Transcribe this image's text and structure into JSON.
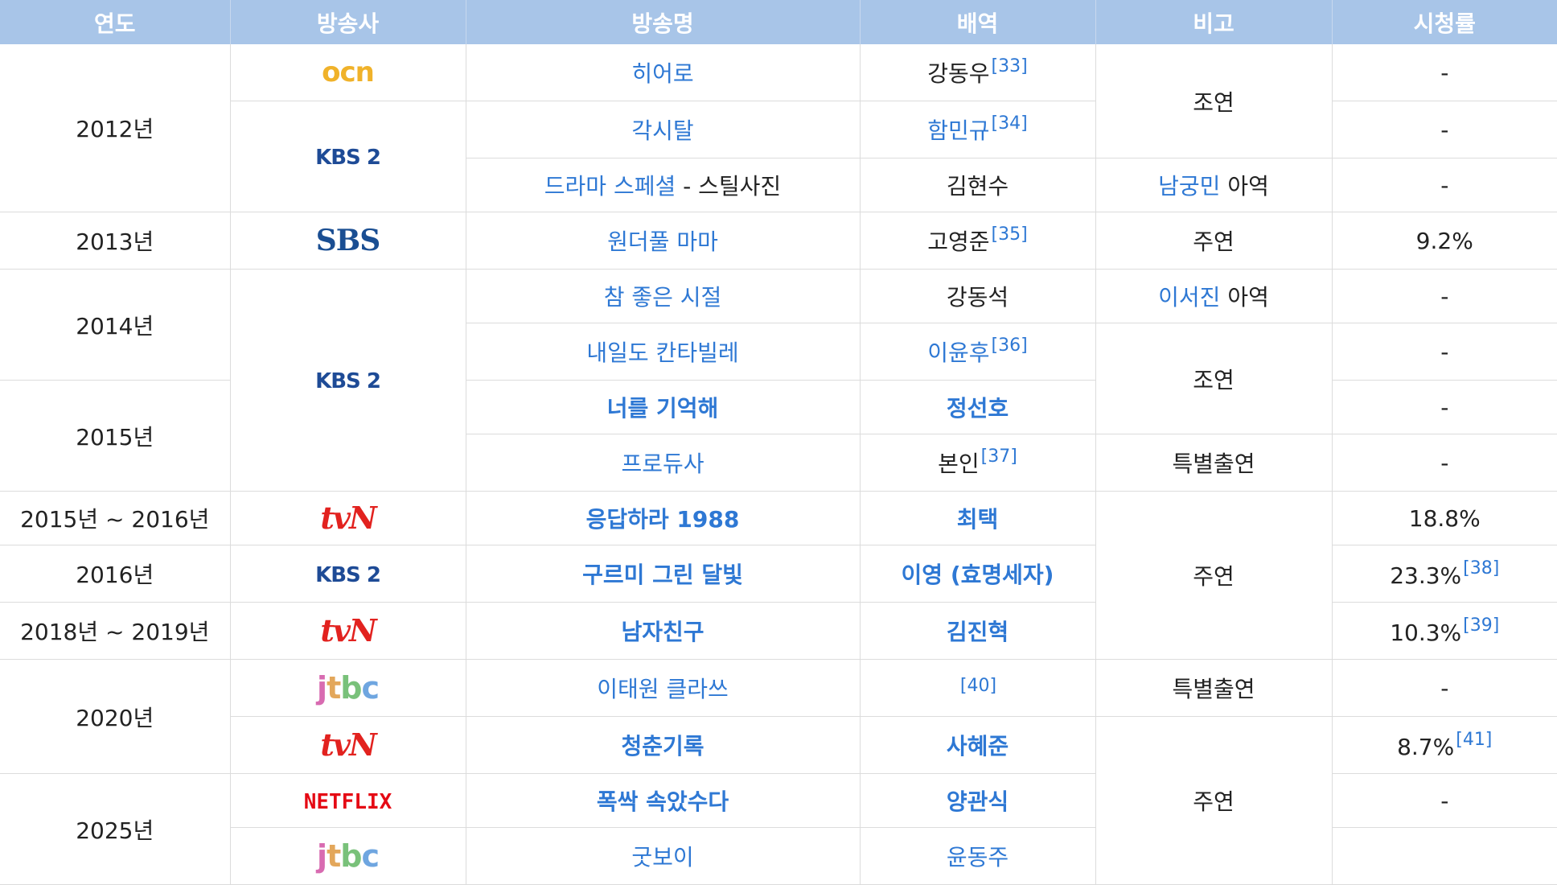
{
  "headers": {
    "year": "연도",
    "broadcaster": "방송사",
    "title": "방송명",
    "role": "배역",
    "note": "비고",
    "rating": "시청률"
  },
  "years": {
    "y2012": "2012년",
    "y2013": "2013년",
    "y2014": "2014년",
    "y2015": "2015년",
    "y2015_2016": "2015년 ~ 2016년",
    "y2016": "2016년",
    "y2018_2019": "2018년 ~ 2019년",
    "y2020": "2020년",
    "y2025": "2025년"
  },
  "logos": {
    "ocn": "OCN",
    "kbs2": "KBS 2",
    "sbs": "SBS",
    "tvn": "tvN",
    "jtbc": [
      "J",
      "T",
      "B",
      "C"
    ],
    "netflix": "NETFLIX"
  },
  "titles": {
    "hero": "히어로",
    "gaksital": "각시탈",
    "drama_special": "드라마 스페셜",
    "drama_special_suffix": " - 스틸사진",
    "wonderful_mama": "원더풀 마마",
    "good_times": "참 좋은 시절",
    "cantabile": "내일도 칸타빌레",
    "remember_you": "너를 기억해",
    "producer": "프로듀사",
    "reply1988": "응답하라 1988",
    "moonlight": "구르미 그린 달빛",
    "boyfriend": "남자친구",
    "itaewon": "이태원 클라쓰",
    "record_youth": "청춘기록",
    "when_life": "폭싹 속았수다",
    "good_boy": "굿보이"
  },
  "roles": {
    "kang_dongwoo": "강동우",
    "ham_mingyu": "함민규",
    "kim_hyunsu": "김현수",
    "go_youngjun": "고영준",
    "kang_dongseok": "강동석",
    "lee_yoonhoo": "이윤후",
    "jung_sunho": "정선호",
    "self": "본인",
    "choi_taek": "최택",
    "lee_young": "이영 (효명세자)",
    "kim_jinhyuk": "김진혁",
    "sa_hyejun": "사혜준",
    "yang_gwansik": "양관식",
    "yoon_dongju": "윤동주"
  },
  "refs": {
    "r33": "[33]",
    "r34": "[34]",
    "r35": "[35]",
    "r36": "[36]",
    "r37": "[37]",
    "r38": "[38]",
    "r39": "[39]",
    "r40": "[40]",
    "r41": "[41]"
  },
  "notes": {
    "supporting": "조연",
    "lead": "주연",
    "cameo": "특별출연",
    "young_role": "아역",
    "nam_gungmin": "남궁민",
    "lee_seojin": "이서진"
  },
  "ratings": {
    "dash": "-",
    "r92": "9.2%",
    "r188": "18.8%",
    "r233": "23.3%",
    "r103": "10.3%",
    "r87": "8.7%"
  }
}
